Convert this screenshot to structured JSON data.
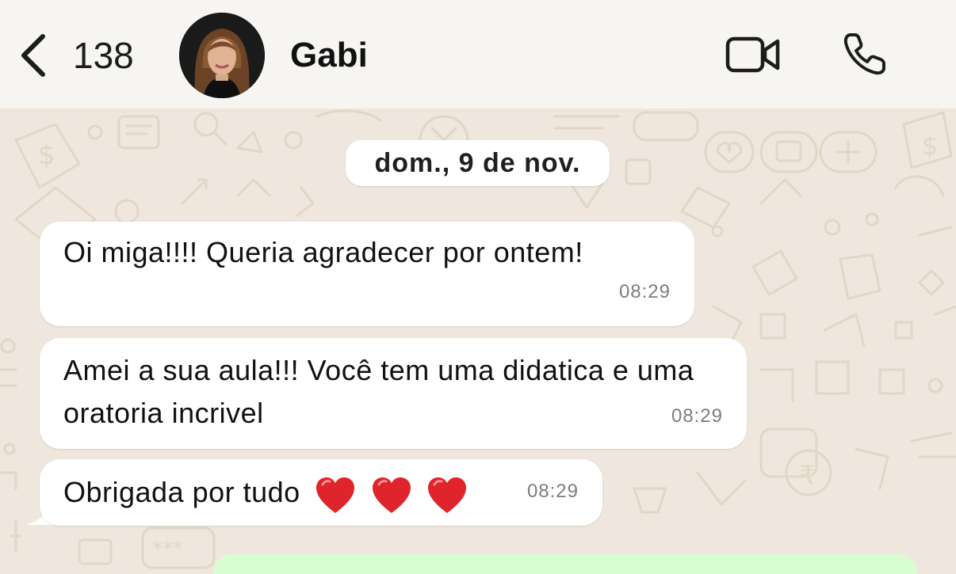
{
  "header": {
    "back_count": "138",
    "contact_name": "Gabi"
  },
  "chat": {
    "date_label": "dom., 9 de nov.",
    "messages": [
      {
        "text": "Oi miga!!!! Queria agradecer por ontem!",
        "time": "08:29"
      },
      {
        "text": "Amei a sua aula!!! Você tem uma didatica e uma oratoria incrivel",
        "time": "08:29"
      },
      {
        "text": "Obrigada por tudo",
        "emoji": "red-heart x3",
        "time": "08:29"
      }
    ]
  },
  "colors": {
    "header_bg": "#f6f5f2",
    "chat_bg": "#efe7dd",
    "incoming_bubble": "#ffffff",
    "outgoing_bubble": "#d9fdd3",
    "heart": "#e0242b"
  },
  "icons": [
    "chevron-left-icon",
    "video-camera-icon",
    "phone-icon",
    "red-heart-icon"
  ]
}
